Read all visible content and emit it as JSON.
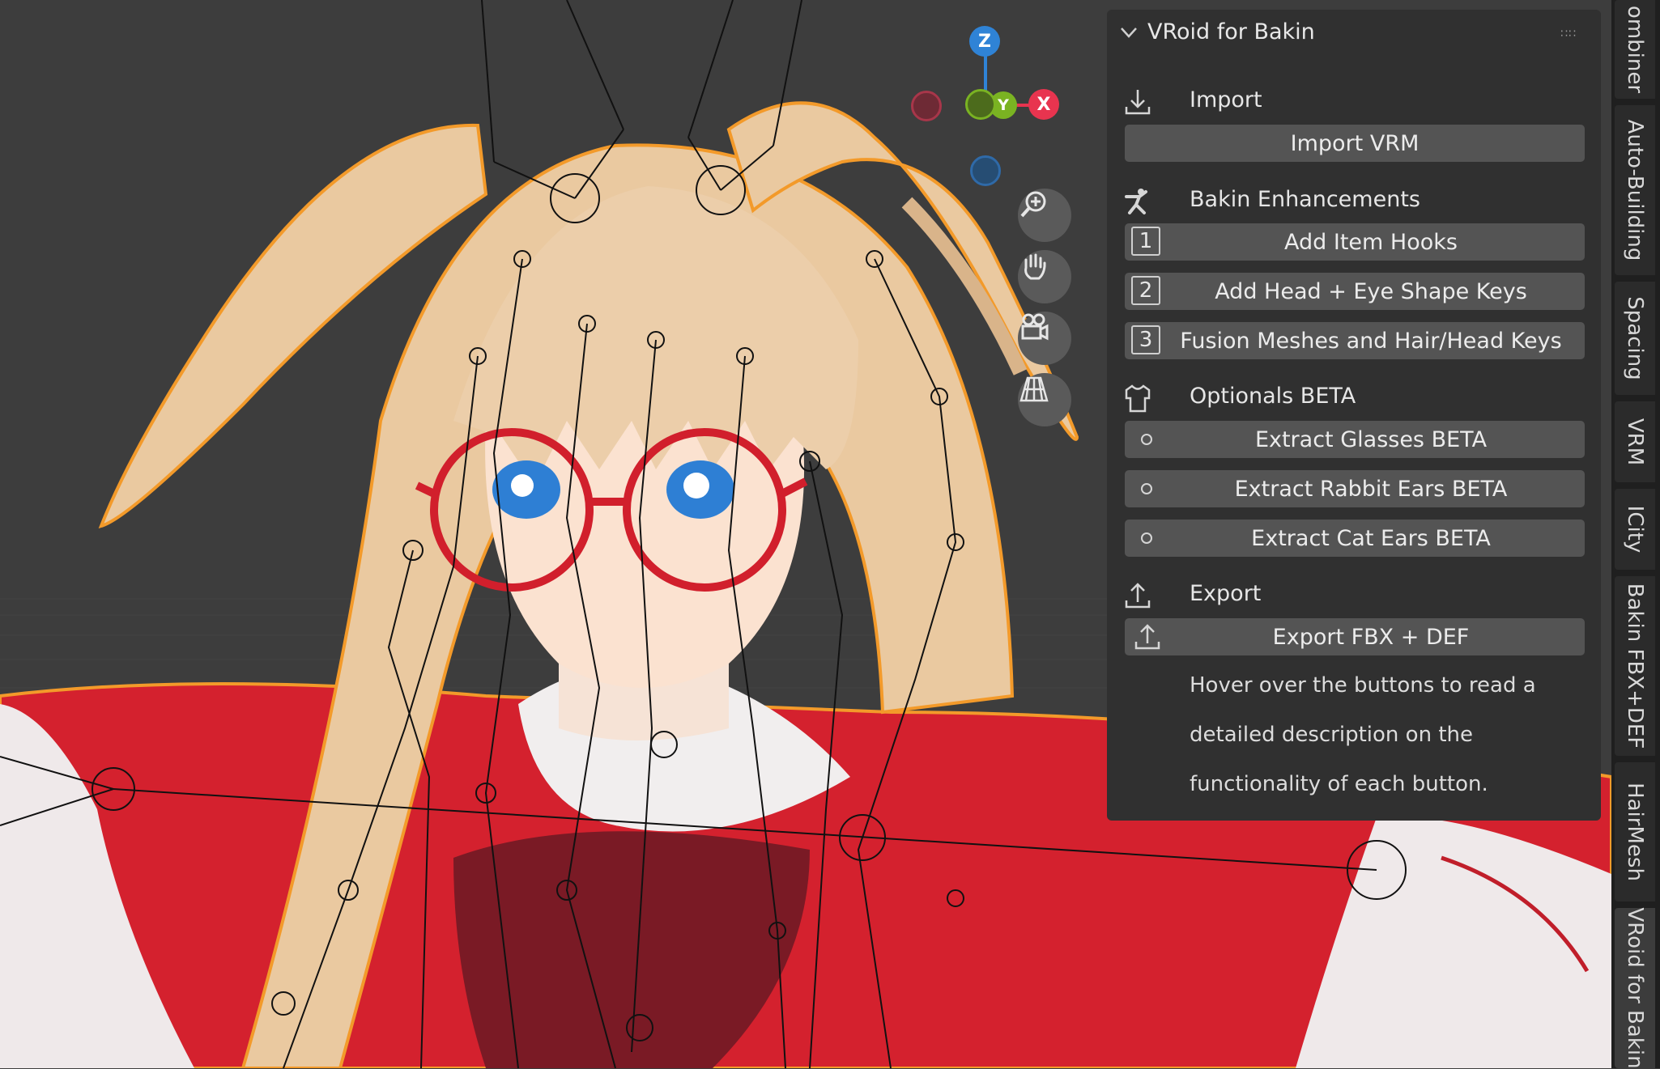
{
  "viewport": {
    "gizmo": {
      "z": "Z",
      "y": "Y",
      "x": "X"
    },
    "nav_tools": [
      "zoom-icon",
      "pan-hand-icon",
      "camera-icon",
      "grid-icon"
    ]
  },
  "panel": {
    "title": "VRoid for Bakin",
    "import": {
      "label": "Import",
      "import_vrm": "Import VRM"
    },
    "enhancements": {
      "label": "Bakin Enhancements",
      "buttons": [
        {
          "num": "1",
          "label": "Add Item Hooks"
        },
        {
          "num": "2",
          "label": "Add Head + Eye Shape Keys"
        },
        {
          "num": "3",
          "label": "Fusion Meshes and Hair/Head Keys"
        }
      ]
    },
    "optionals": {
      "label": "Optionals BETA",
      "buttons": [
        "Extract Glasses BETA",
        "Extract Rabbit Ears BETA",
        "Extract Cat Ears BETA"
      ]
    },
    "export": {
      "label": "Export",
      "button": "Export FBX + DEF"
    },
    "hint_lines": [
      "Hover over the buttons to read a",
      "detailed description on the",
      "functionality of each button."
    ]
  },
  "tabs": [
    "ombiner",
    "Auto-Building",
    "Spacing",
    "VRM",
    "ICity",
    "Bakin FBX+DEF",
    "HairMesh",
    "VRoid for Bakin"
  ],
  "colors": {
    "panel_bg": "#303030",
    "button_bg": "#545454",
    "outline": "#f39a2a",
    "outfit_red": "#d4212e",
    "hair": "#eac9a0",
    "axis_x": "#e8344f",
    "axis_y": "#7ab322",
    "axis_z": "#2f83d6"
  }
}
